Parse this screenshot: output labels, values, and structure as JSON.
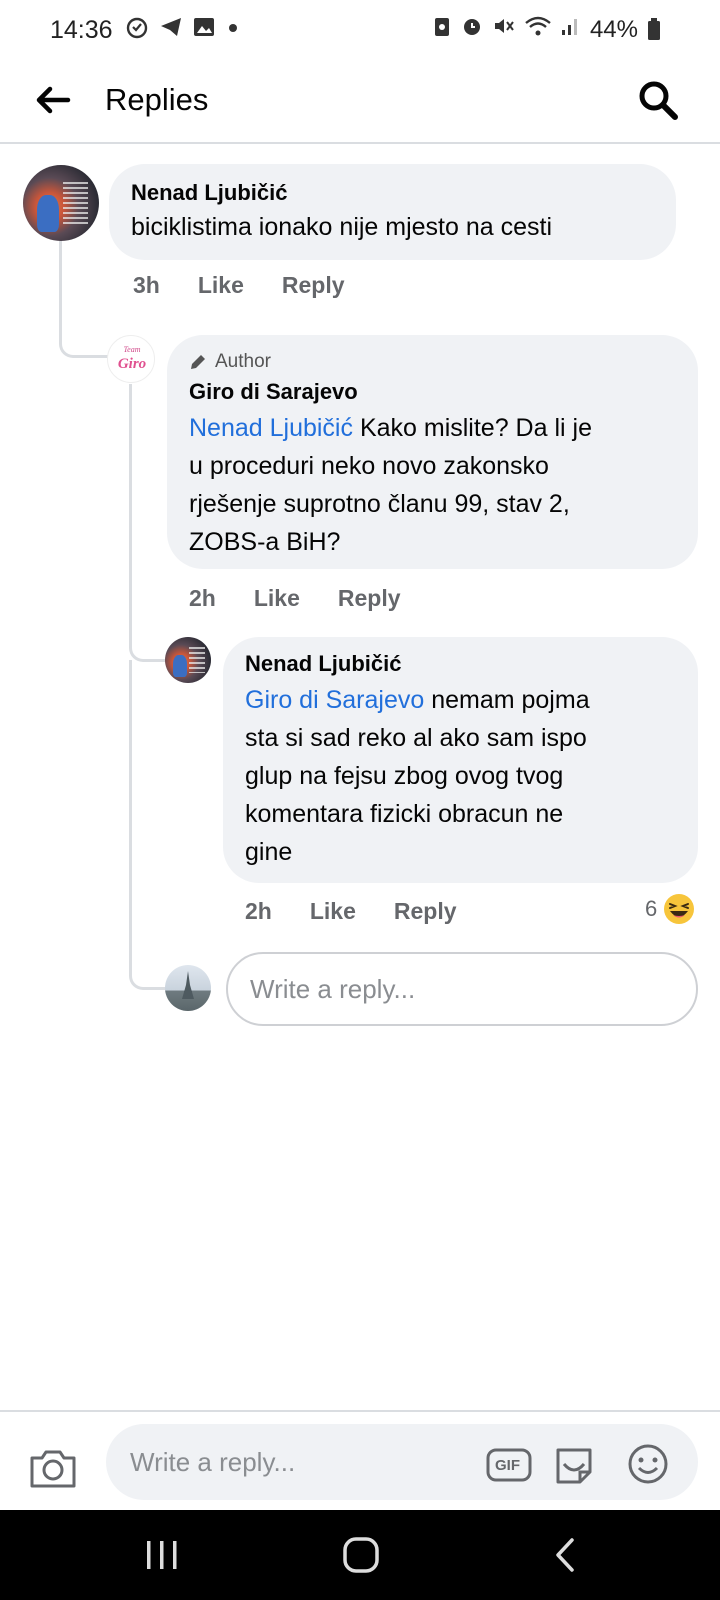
{
  "status_bar": {
    "time": "14:36",
    "battery": "44%"
  },
  "header": {
    "title": "Replies"
  },
  "comments": [
    {
      "author": "Nenad Ljubičić",
      "text": "biciklistima ionako nije mjesto na cesti",
      "time": "3h",
      "like_label": "Like",
      "reply_label": "Reply"
    },
    {
      "badge": "Author",
      "author": "Giro di Sarajevo",
      "mention": "Nenad Ljubičić",
      "text_line1": " Kako mislite? Da li je",
      "text_lines": [
        "u proceduri neko novo zakonsko",
        "rješenje suprotno članu 99, stav 2,",
        "ZOBS-a BiH?"
      ],
      "time": "2h",
      "like_label": "Like",
      "reply_label": "Reply",
      "avatar_text": "Team Giro"
    },
    {
      "author": "Nenad Ljubičić",
      "mention": "Giro di Sarajevo",
      "text_line1": " nemam pojma",
      "text_lines": [
        "sta si sad reko al ako sam ispo",
        "glup na fejsu zbog ovog tvog",
        "komentara fizicki obracun ne",
        "gine"
      ],
      "time": "2h",
      "like_label": "Like",
      "reply_label": "Reply",
      "reaction_count": "6",
      "reaction_icon": "haha-emoji-icon"
    }
  ],
  "inline_reply": {
    "placeholder": "Write a reply..."
  },
  "composer": {
    "placeholder": "Write a reply...",
    "gif_label": "GIF"
  },
  "colors": {
    "mention": "#216fdb",
    "bubble": "#f0f2f5",
    "meta": "#65676b"
  }
}
